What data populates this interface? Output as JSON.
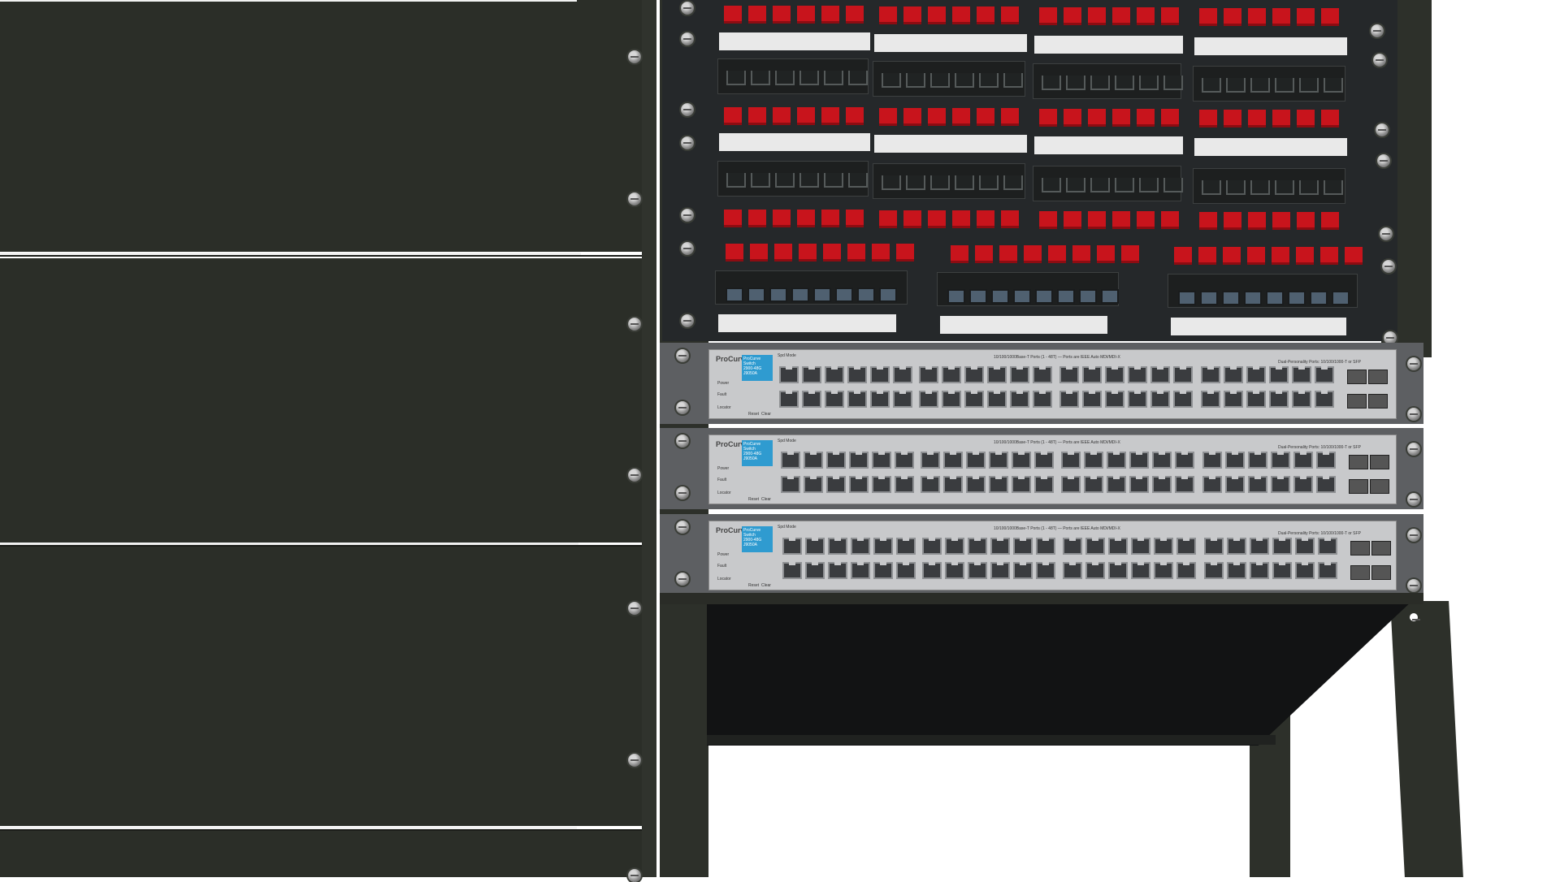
{
  "scene": "3D render of a network equipment rack with patch panels and three ProCurve switches beside a dark side panel",
  "switches": [
    {
      "brand": "ProCurve",
      "model_line1": "ProCurve Switch",
      "model_line2": "2900-48G",
      "model_line3": "J9050A"
    },
    {
      "brand": "ProCurve",
      "model_line1": "ProCurve Switch",
      "model_line2": "2900-48G",
      "model_line3": "J9050A"
    },
    {
      "brand": "ProCurve",
      "model_line1": "ProCurve Switch",
      "model_line2": "2900-48G",
      "model_line3": "J9050A"
    }
  ],
  "switch_labels": {
    "power": "Power",
    "fault": "Fault",
    "locator": "Locator",
    "reset": "Reset",
    "clear": "Clear",
    "spd_mode": "Spd Mode",
    "ports_desc": "10/100/1000Base-T Ports (1 - 48T) — Ports are IEEE Auto MDI/MDI-X",
    "dual_personality": "Dual-Personality Ports: 10/100/1000-T or SFP"
  },
  "colors": {
    "side_panel": "#2b2e28",
    "rack": "#2d302a",
    "red_jack": "#c8141c",
    "label_strip": "#e9e9e9",
    "switch_face": "#c8c9cb",
    "model_badge": "#2f9bd0",
    "background": "#ffffff"
  },
  "icons": [
    "bolt-icon",
    "rj45-port-icon",
    "keystone-jack-icon",
    "sfp-port-icon"
  ]
}
